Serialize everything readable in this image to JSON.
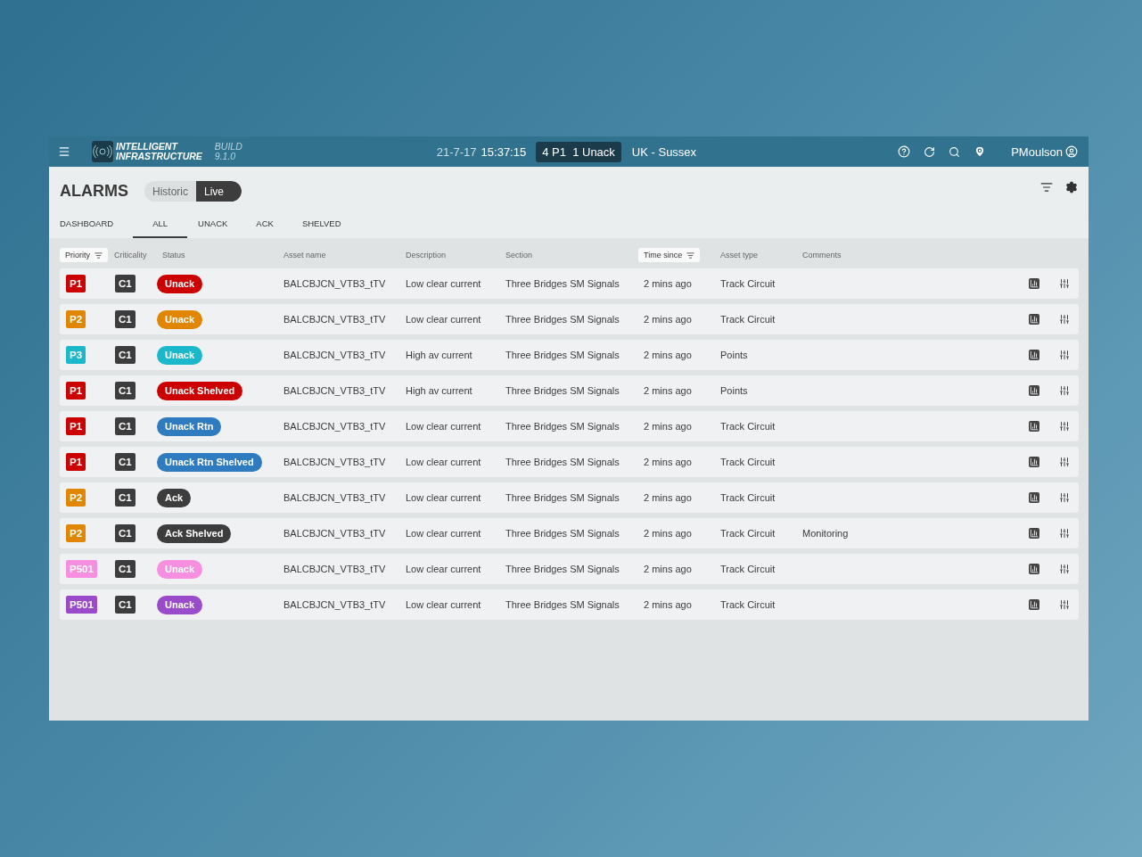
{
  "header": {
    "brand_line_1": "INTELLIGENT",
    "brand_line_2": "INFRASTRUCTURE",
    "build_label": "BUILD",
    "build_version": "9.1.0",
    "date": "21-7-17",
    "time": "15:37:15",
    "alert_summary": "4 P1  1 Unack",
    "region": "UK - Sussex",
    "user": "PMoulson"
  },
  "page": {
    "title": "ALARMS",
    "mode_toggle": [
      {
        "label": "Historic",
        "selected": false
      },
      {
        "label": "Live",
        "selected": true
      }
    ]
  },
  "tabs": [
    {
      "label": "DASHBOARD",
      "selected": false
    },
    {
      "label": "ALL",
      "selected": true
    },
    {
      "label": "UNACK",
      "selected": false
    },
    {
      "label": "ACK",
      "selected": false
    },
    {
      "label": "SHELVED",
      "selected": false
    }
  ],
  "table": {
    "columns": [
      {
        "label": "Priority",
        "sorted": true
      },
      {
        "label": "Criticality",
        "sorted": false
      },
      {
        "label": "Status",
        "sorted": false
      },
      {
        "label": "Asset name",
        "sorted": false
      },
      {
        "label": "Description",
        "sorted": false
      },
      {
        "label": "Section",
        "sorted": false
      },
      {
        "label": "Time since",
        "sorted": true
      },
      {
        "label": "Asset type",
        "sorted": false
      },
      {
        "label": "Comments",
        "sorted": false
      }
    ],
    "rows": [
      {
        "priority": {
          "label": "P1",
          "color": "#cc0000"
        },
        "criticality": "C1",
        "status": {
          "label": "Unack",
          "color": "#cc0000"
        },
        "asset": "BALCBJCN_VTB3_tTV",
        "description": "Low clear current",
        "section": "Three Bridges SM Signals",
        "time": "2 mins ago",
        "asset_type": "Track Circuit"
      },
      {
        "priority": {
          "label": "P2",
          "color": "#e08600"
        },
        "criticality": "C1",
        "status": {
          "label": "Unack",
          "color": "#e08600"
        },
        "asset": "BALCBJCN_VTB3_tTV",
        "description": "Low clear current",
        "section": "Three Bridges SM Signals",
        "time": "2 mins ago",
        "asset_type": "Track Circuit"
      },
      {
        "priority": {
          "label": "P3",
          "color": "#1bb8cc"
        },
        "criticality": "C1",
        "status": {
          "label": "Unack",
          "color": "#1bb8cc"
        },
        "asset": "BALCBJCN_VTB3_tTV",
        "description": "High av current",
        "section": "Three Bridges SM Signals",
        "time": "2 mins ago",
        "asset_type": "Points"
      },
      {
        "priority": {
          "label": "P1",
          "color": "#cc0000"
        },
        "criticality": "C1",
        "status": {
          "label": "Unack Shelved",
          "color": "#cc0000"
        },
        "asset": "BALCBJCN_VTB3_tTV",
        "description": "High av current",
        "section": "Three Bridges SM Signals",
        "time": "2 mins ago",
        "asset_type": "Points"
      },
      {
        "priority": {
          "label": "P1",
          "color": "#cc0000"
        },
        "criticality": "C1",
        "status": {
          "label": "Unack Rtn",
          "color": "#2f7bbf"
        },
        "asset": "BALCBJCN_VTB3_tTV",
        "description": "Low clear current",
        "section": "Three Bridges SM Signals",
        "time": "2 mins ago",
        "asset_type": "Track Circuit"
      },
      {
        "priority": {
          "label": "P1",
          "color": "#cc0000"
        },
        "criticality": "C1",
        "status": {
          "label": "Unack Rtn Shelved",
          "color": "#2f7bbf"
        },
        "asset": "BALCBJCN_VTB3_tTV",
        "description": "Low clear current",
        "section": "Three Bridges SM Signals",
        "time": "2 mins ago",
        "asset_type": "Track Circuit"
      },
      {
        "priority": {
          "label": "P2",
          "color": "#e08600"
        },
        "criticality": "C1",
        "status": {
          "label": "Ack",
          "color": "#3d3d3d"
        },
        "asset": "BALCBJCN_VTB3_tTV",
        "description": "Low clear current",
        "section": "Three Bridges SM Signals",
        "time": "2 mins ago",
        "asset_type": "Track Circuit"
      },
      {
        "priority": {
          "label": "P2",
          "color": "#e08600"
        },
        "criticality": "C1",
        "status": {
          "label": "Ack Shelved",
          "color": "#3d3d3d"
        },
        "asset": "BALCBJCN_VTB3_tTV",
        "description": "Low clear current",
        "section": "Three Bridges SM Signals",
        "time": "2 mins ago",
        "asset_type": "Track Circuit",
        "comment": "Monitoring"
      },
      {
        "priority": {
          "label": "P501",
          "color": "#f78fe0"
        },
        "criticality": "C1",
        "status": {
          "label": "Unack",
          "color": "#f78fe0"
        },
        "asset": "BALCBJCN_VTB3_tTV",
        "description": "Low clear current",
        "section": "Three Bridges SM Signals",
        "time": "2 mins ago",
        "asset_type": "Track Circuit"
      },
      {
        "priority": {
          "label": "P501",
          "color": "#9a4bc9"
        },
        "criticality": "C1",
        "status": {
          "label": "Unack",
          "color": "#9a4bc9"
        },
        "asset": "BALCBJCN_VTB3_tTV",
        "description": "Low clear current",
        "section": "Three Bridges SM Signals",
        "time": "2 mins ago",
        "asset_type": "Track Circuit"
      }
    ]
  }
}
